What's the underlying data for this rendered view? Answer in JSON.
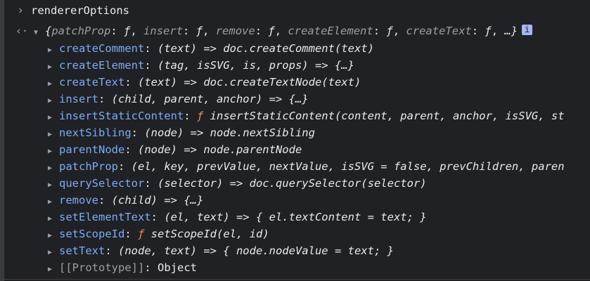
{
  "console": {
    "command": "rendererOptions",
    "summary": {
      "open": "{",
      "items": [
        {
          "key": "patchProp",
          "value": "ƒ"
        },
        {
          "key": "insert",
          "value": "ƒ"
        },
        {
          "key": "remove",
          "value": "ƒ"
        },
        {
          "key": "createElement",
          "value": "ƒ"
        },
        {
          "key": "createText",
          "value": "ƒ"
        }
      ],
      "ellipsis": "…}",
      "info": "i"
    },
    "properties": [
      {
        "name": "createComment",
        "fmark": "",
        "value": "(text) => doc.createComment(text)"
      },
      {
        "name": "createElement",
        "fmark": "",
        "value": "(tag, isSVG, is, props) => {…}"
      },
      {
        "name": "createText",
        "fmark": "",
        "value": "(text) => doc.createTextNode(text)"
      },
      {
        "name": "insert",
        "fmark": "",
        "value": "(child, parent, anchor) => {…}"
      },
      {
        "name": "insertStaticContent",
        "fmark": "ƒ",
        "value": "insertStaticContent(content, parent, anchor, isSVG, st"
      },
      {
        "name": "nextSibling",
        "fmark": "",
        "value": "(node) => node.nextSibling"
      },
      {
        "name": "parentNode",
        "fmark": "",
        "value": "(node) => node.parentNode"
      },
      {
        "name": "patchProp",
        "fmark": "",
        "value": "(el, key, prevValue, nextValue, isSVG = false, prevChildren, paren"
      },
      {
        "name": "querySelector",
        "fmark": "",
        "value": "(selector) => doc.querySelector(selector)"
      },
      {
        "name": "remove",
        "fmark": "",
        "value": "(child) => {…}"
      },
      {
        "name": "setElementText",
        "fmark": "",
        "value": "(el, text) => { el.textContent = text; }"
      },
      {
        "name": "setScopeId",
        "fmark": "ƒ",
        "value": "setScopeId(el, id)"
      },
      {
        "name": "setText",
        "fmark": "",
        "value": "(node, text) => { node.nodeValue = text; }"
      }
    ],
    "prototype": {
      "name": "[[Prototype]]",
      "value": "Object"
    }
  }
}
